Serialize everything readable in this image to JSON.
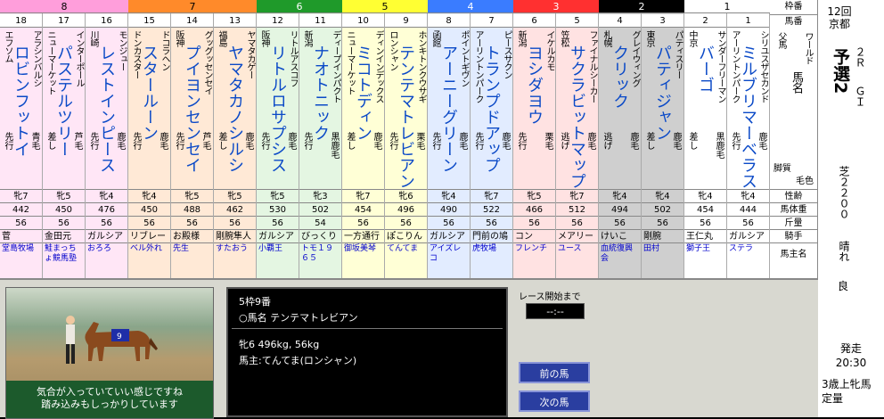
{
  "race": {
    "number": "12回",
    "venue": "京都",
    "name": "予選2",
    "round": "２Ｒ",
    "grade": "ＧＩ",
    "distance": "芝２２００",
    "weather": "晴れ",
    "going": "良",
    "start_label": "発走",
    "start_time": "20:30",
    "conditions": "3歳上牝馬",
    "rule": "定量"
  },
  "labels": {
    "frame": "枠番",
    "number": "馬番",
    "sire": "父馬",
    "horse": "馬名",
    "dam": "ワールド",
    "style": "脚質",
    "coat": "毛色",
    "age": "性齢",
    "weight": "馬体重",
    "load": "斤量",
    "jockey": "騎手",
    "owner": "馬主名"
  },
  "frames": [
    {
      "label": "8",
      "color": "#ff9edb",
      "horses": [
        18,
        17,
        16
      ]
    },
    {
      "label": "7",
      "color": "#ff8a2a",
      "horses": [
        15,
        14,
        13
      ]
    },
    {
      "label": "6",
      "color": "#1f9a2a",
      "horses": [
        12,
        11
      ]
    },
    {
      "label": "5",
      "color": "#ffff33",
      "horses": [
        10,
        9
      ]
    },
    {
      "label": "4",
      "color": "#3a7cff",
      "horses": [
        8,
        7
      ]
    },
    {
      "label": "3",
      "color": "#ff3030",
      "horses": [
        6,
        5
      ]
    },
    {
      "label": "2",
      "color": "#000000",
      "horses": [
        4,
        3
      ]
    },
    {
      "label": "1",
      "color": "#ffffff",
      "horses": [
        2,
        1
      ]
    }
  ],
  "horses": [
    {
      "num": "18",
      "bg": "#ffe6f6",
      "sire": "アラシンバルシ",
      "dam": "エフソム",
      "name": "ロビンフットイ",
      "region": "",
      "style": "先行",
      "coat": "青毛",
      "age": "牝7",
      "weight": "442",
      "load": "56",
      "jockey": "菅",
      "owner": "堂島牧場"
    },
    {
      "num": "17",
      "bg": "#ffe6f6",
      "sire": "インターポール",
      "dam": "ニューマーケット",
      "name": "パステルツリー",
      "region": "",
      "style": "差し",
      "coat": "芦毛",
      "age": "牝5",
      "weight": "450",
      "load": "56",
      "jockey": "金田元",
      "owner": "鮭まっちょ競馬塾"
    },
    {
      "num": "16",
      "bg": "#ffe6f6",
      "sire": "モンジュー",
      "dam": "川崎",
      "name": "レストインピース",
      "region": "",
      "style": "先行",
      "coat": "鹿毛",
      "age": "牝4",
      "weight": "476",
      "load": "56",
      "jockey": "ガルシア",
      "owner": "おろろ"
    },
    {
      "num": "15",
      "bg": "#ffe9d6",
      "sire": "ドコラヘン",
      "dam": "ドンカスター",
      "name": "スタールーン",
      "region": "",
      "style": "先行",
      "coat": "鹿毛",
      "age": "牝4",
      "weight": "450",
      "load": "56",
      "jockey": "リブレー",
      "owner": "ベル外れ"
    },
    {
      "num": "14",
      "bg": "#ffe9d6",
      "sire": "グッグッセンセイ",
      "dam": "阪神",
      "name": "プイヨンセンセイ",
      "region": "",
      "style": "先行",
      "coat": "芦毛",
      "age": "牝5",
      "weight": "488",
      "load": "56",
      "jockey": "お殿様",
      "owner": "先生"
    },
    {
      "num": "13",
      "bg": "#ffe9d6",
      "sire": "ヤマタカゲー",
      "dam": "福島",
      "name": "ヤマタカノシルシ",
      "region": "",
      "style": "差し",
      "coat": "鹿毛",
      "age": "牝5",
      "weight": "462",
      "load": "56",
      "jockey": "剛腕隼人",
      "owner": "すたおう"
    },
    {
      "num": "12",
      "bg": "#e4f6e2",
      "sire": "リトルアスコフ",
      "dam": "阪神",
      "name": "リトルロサプシス",
      "region": "",
      "style": "先行",
      "coat": "鹿毛",
      "age": "牝5",
      "weight": "530",
      "load": "56",
      "jockey": "ガルシア",
      "owner": "小覇王"
    },
    {
      "num": "11",
      "bg": "#e4f6e2",
      "sire": "ディープインパクト",
      "dam": "新潟",
      "name": "ナオトニック",
      "region": "",
      "style": "先行",
      "coat": "黒鹿毛",
      "age": "牝3",
      "weight": "502",
      "load": "54",
      "jockey": "びっくり",
      "owner": "トモ１９６５"
    },
    {
      "num": "10",
      "bg": "#ffffd6",
      "sire": "ディンインデックス",
      "dam": "ニューマーケット",
      "name": "ミコトディン",
      "region": "",
      "style": "差し",
      "coat": "鹿毛",
      "age": "牝7",
      "weight": "454",
      "load": "56",
      "jockey": "一方通行",
      "owner": "御坂美琴"
    },
    {
      "num": "9",
      "bg": "#ffffd6",
      "sire": "ホンキトンクウサギ",
      "dam": "ロンシャン",
      "name": "テンテマトレビアン",
      "region": "",
      "style": "先行",
      "coat": "栗毛",
      "age": "牝6",
      "weight": "496",
      "load": "56",
      "jockey": "ぽこりん",
      "owner": "てんてま"
    },
    {
      "num": "8",
      "bg": "#e2ecff",
      "sire": "ポイントギヴン",
      "dam": "函館",
      "name": "アーニーグリーン",
      "region": "",
      "style": "先行",
      "coat": "鹿毛",
      "age": "牝4",
      "weight": "490",
      "load": "56",
      "jockey": "ガルシア",
      "owner": "アイズレコ"
    },
    {
      "num": "7",
      "bg": "#e2ecff",
      "sire": "ピースサクン",
      "dam": "アーリントンパーク",
      "name": "トランプドアップ",
      "region": "",
      "style": "先行",
      "coat": "鹿毛",
      "age": "牝7",
      "weight": "522",
      "load": "56",
      "jockey": "門前の鳩",
      "owner": "虎牧場"
    },
    {
      "num": "6",
      "bg": "#ffe2e2",
      "sire": "イケルカモ",
      "dam": "新潟",
      "name": "ヨシダヨウ",
      "region": "",
      "style": "先行",
      "coat": "栗毛",
      "age": "牝5",
      "weight": "466",
      "load": "56",
      "jockey": "コン",
      "owner": "フレンチ"
    },
    {
      "num": "5",
      "bg": "#ffe2e2",
      "sire": "ファイナルシーカー",
      "dam": "笠松",
      "name": "サクラビットマップ",
      "region": "",
      "style": "逃げ",
      "coat": "鹿毛",
      "age": "牝7",
      "weight": "512",
      "load": "56",
      "jockey": "メアリー",
      "owner": "ユース"
    },
    {
      "num": "4",
      "bg": "#cfcfcf",
      "sire": "グレイウィング",
      "dam": "札幌",
      "name": "クリック",
      "region": "",
      "style": "逃げ",
      "coat": "鹿毛",
      "age": "牝4",
      "weight": "494",
      "load": "56",
      "jockey": "けいこ",
      "owner": "血統復興会"
    },
    {
      "num": "3",
      "bg": "#cfcfcf",
      "sire": "パティスリー",
      "dam": "東京",
      "name": "パティジャン",
      "region": "",
      "style": "差し",
      "coat": "鹿毛",
      "age": "牝4",
      "weight": "502",
      "load": "56",
      "jockey": "剛腕",
      "owner": "田村"
    },
    {
      "num": "2",
      "bg": "#ffffff",
      "sire": "サンダーフリーマン",
      "dam": "中京",
      "name": "バーゴ",
      "region": "",
      "style": "差し",
      "coat": "黒鹿毛",
      "age": "牝4",
      "weight": "454",
      "load": "56",
      "jockey": "王仁丸",
      "owner": "獅子王"
    },
    {
      "num": "1",
      "bg": "#ffffff",
      "sire": "シリユスザセカンド",
      "dam": "アーリントンパーク",
      "name": "ミルブリマーベラス",
      "region": "",
      "style": "先行",
      "coat": "鹿毛",
      "age": "牝4",
      "weight": "444",
      "load": "56",
      "jockey": "ガルシア",
      "owner": "ステラ"
    }
  ],
  "detail": {
    "line1": "5枠9番",
    "line2": "○馬名 テンテマトレビアン",
    "line3": "牝6  496kg, 56kg",
    "line4": "馬主:てんてま(ロンシャン)"
  },
  "video": {
    "horse_number": "9",
    "comment": "気合が入っていていい感じですね\n踏み込みもしっかりしています"
  },
  "timer": {
    "label": "レース開始まで",
    "value": "--:--"
  },
  "buttons": {
    "prev": "前の馬",
    "next": "次の馬"
  }
}
